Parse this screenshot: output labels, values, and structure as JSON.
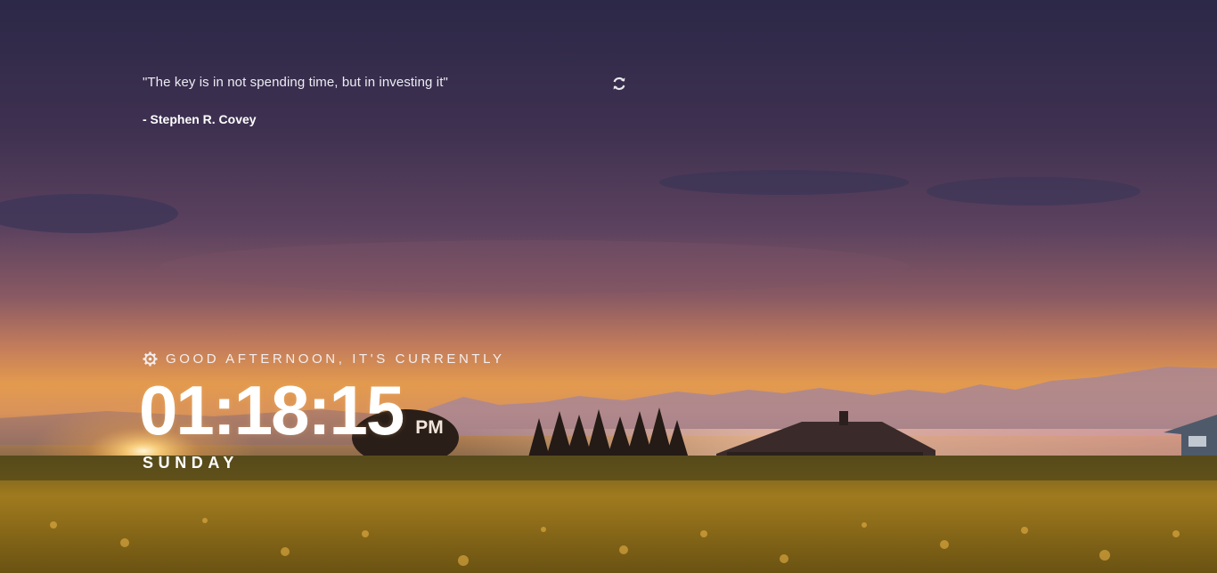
{
  "quote": {
    "text": "\"The key is in not spending time, but in investing it\"",
    "author": "- Stephen R. Covey",
    "refresh_icon": "refresh-icon"
  },
  "greeting": {
    "settings_icon": "gear-icon",
    "text": "GOOD AFTERNOON, IT'S CURRENTLY"
  },
  "clock": {
    "time": "01:18:15",
    "period": "PM",
    "day": "SUNDAY"
  },
  "background": {
    "description_colors": {
      "sky_top": "#2f2a4a",
      "sky_mid": "#6c4a6a",
      "horizon": "#e89a45",
      "field": "#8a6a1c"
    }
  }
}
